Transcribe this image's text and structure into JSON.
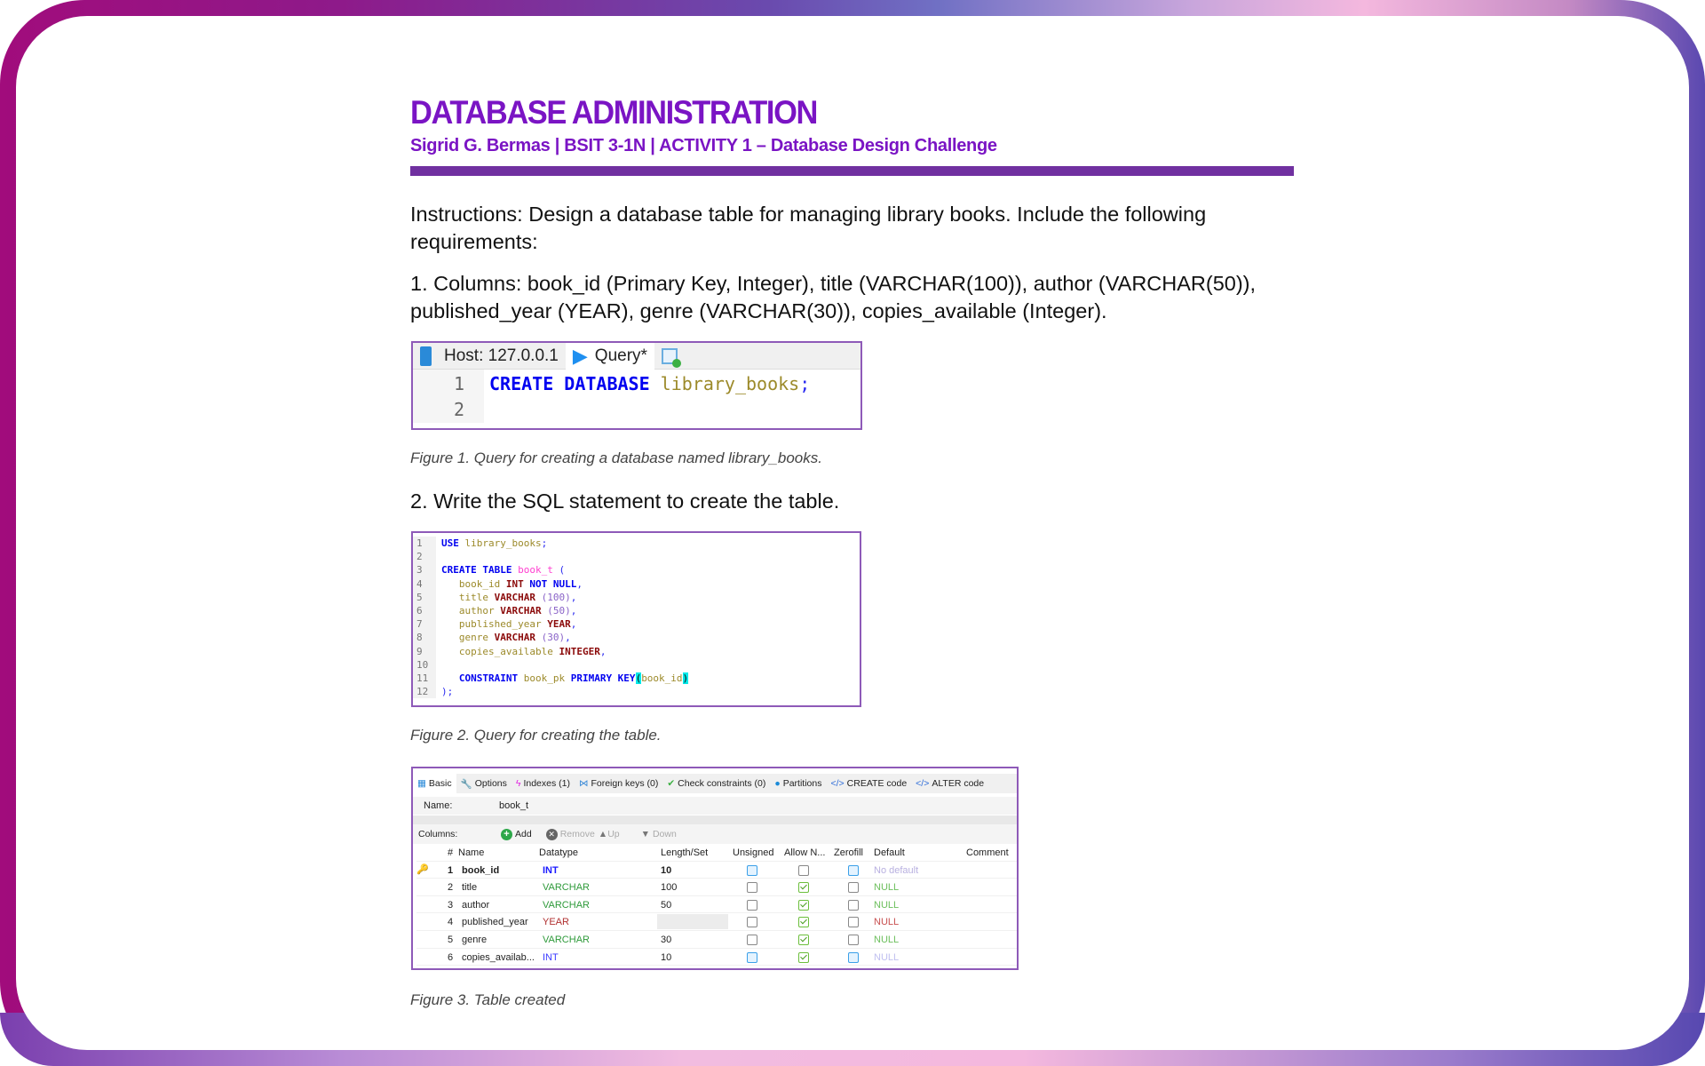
{
  "header": {
    "title": "DATABASE ADMINISTRATION",
    "subtitle": "Sigrid G. Bermas | BSIT 3-1N | ACTIVITY 1 – Database Design Challenge",
    "accent": "#7a14c4",
    "rule_color": "#7030a0"
  },
  "instructions": {
    "line1": "Instructions: Design a database table for managing library books. Include the following",
    "line2": "requirements:"
  },
  "item1": {
    "line1": "1. Columns: book_id (Primary Key, Integer), title (VARCHAR(100)), author (VARCHAR(50)),",
    "line2": "published_year (YEAR), genre (VARCHAR(30)), copies_available (Integer)."
  },
  "figure1": {
    "tabs": [
      {
        "label": "Host: 127.0.0.1",
        "icon": "server-icon"
      },
      {
        "label": "Query*",
        "icon": "play-icon"
      },
      {
        "label": "",
        "icon": "new-query-icon"
      }
    ],
    "line_numbers": [
      "1",
      "2"
    ],
    "code": [
      [
        [
          "CREATE DATABASE ",
          "kw"
        ],
        [
          "library_books",
          "id"
        ],
        [
          ";",
          "pu"
        ]
      ],
      []
    ],
    "caption": "Figure 1. Query for creating a database named library_books."
  },
  "item2": "2. Write the SQL statement to create the table.",
  "figure2": {
    "line_numbers": [
      "1",
      "2",
      "3",
      "4",
      "5",
      "6",
      "7",
      "8",
      "9",
      "10",
      "11",
      "12"
    ],
    "code": [
      [
        [
          "USE ",
          "kw"
        ],
        [
          "library_books",
          "id"
        ],
        [
          ";",
          "pu"
        ]
      ],
      [],
      [
        [
          "CREATE TABLE ",
          "kw"
        ],
        [
          "book_t",
          "tb"
        ],
        [
          " (",
          "pu"
        ]
      ],
      [
        [
          "   book_id ",
          "id"
        ],
        [
          "INT ",
          "ty"
        ],
        [
          "NOT NULL",
          "kw"
        ],
        [
          ",",
          "pu"
        ]
      ],
      [
        [
          "   title ",
          "id"
        ],
        [
          "VARCHAR ",
          "ty"
        ],
        [
          "(",
          "nu"
        ],
        [
          "100",
          "nu"
        ],
        [
          ")",
          "nu"
        ],
        [
          ",",
          "pu"
        ]
      ],
      [
        [
          "   author ",
          "id"
        ],
        [
          "VARCHAR ",
          "ty"
        ],
        [
          "(50)",
          "nu"
        ],
        [
          ",",
          "pu"
        ]
      ],
      [
        [
          "   published_year ",
          "id"
        ],
        [
          "YEAR",
          "ty"
        ],
        [
          ",",
          "pu"
        ]
      ],
      [
        [
          "   genre ",
          "id"
        ],
        [
          "VARCHAR ",
          "ty"
        ],
        [
          "(30)",
          "nu"
        ],
        [
          ",",
          "pu"
        ]
      ],
      [
        [
          "   copies_available ",
          "id"
        ],
        [
          "INTEGER",
          "ty"
        ],
        [
          ",",
          "pu"
        ]
      ],
      [],
      [
        [
          "   CONSTRAINT ",
          "kw"
        ],
        [
          "book_pk ",
          "id"
        ],
        [
          "PRIMARY KEY",
          "kw"
        ],
        [
          "(",
          "hl"
        ],
        [
          "book_id",
          "id"
        ],
        [
          ")",
          "hl"
        ]
      ],
      [
        [
          ");",
          "pu"
        ]
      ]
    ],
    "caption": "Figure 2. Query for creating the table."
  },
  "figure3": {
    "tabs": [
      {
        "label": "Basic",
        "icon": "table-icon"
      },
      {
        "label": "Options",
        "icon": "wrench-icon"
      },
      {
        "label": "Indexes (1)",
        "icon": "lightning-icon"
      },
      {
        "label": "Foreign keys (0)",
        "icon": "foreign-key-icon"
      },
      {
        "label": "Check constraints (0)",
        "icon": "check-icon"
      },
      {
        "label": "Partitions",
        "icon": "pie-icon"
      },
      {
        "label": "CREATE code",
        "icon": "code-icon"
      },
      {
        "label": "ALTER code",
        "icon": "code-icon"
      }
    ],
    "name_label": "Name:",
    "name_value": "book_t",
    "columns_label": "Columns:",
    "buttons": {
      "add": "Add",
      "remove": "Remove",
      "up": "Up",
      "down": "Down"
    },
    "headers": [
      "#",
      "Name",
      "Datatype",
      "Length/Set",
      "Unsigned",
      "Allow N...",
      "Zerofill",
      "Default",
      "Comment"
    ],
    "rows": [
      {
        "num": "1",
        "name": "book_id",
        "type": "INT",
        "type_color": "#1a1aff",
        "length": "10",
        "unsigned": "blue",
        "allow_null": "off",
        "zerofill": "blue",
        "default": "No default",
        "default_color": "#b8b0e0",
        "primary_key": true,
        "bold": true
      },
      {
        "num": "2",
        "name": "title",
        "type": "VARCHAR",
        "type_color": "#2e9a3a",
        "length": "100",
        "unsigned": "off",
        "allow_null": "checked",
        "zerofill": "off",
        "default": "NULL",
        "default_color": "#6cbf5c"
      },
      {
        "num": "3",
        "name": "author",
        "type": "VARCHAR",
        "type_color": "#2e9a3a",
        "length": "50",
        "unsigned": "off",
        "allow_null": "checked",
        "zerofill": "off",
        "default": "NULL",
        "default_color": "#6cbf5c"
      },
      {
        "num": "4",
        "name": "published_year",
        "type": "YEAR",
        "type_color": "#b03030",
        "length": "",
        "unsigned": "off",
        "allow_null": "checked",
        "zerofill": "off",
        "default": "NULL",
        "default_color": "#c85050"
      },
      {
        "num": "5",
        "name": "genre",
        "type": "VARCHAR",
        "type_color": "#2e9a3a",
        "length": "30",
        "unsigned": "off",
        "allow_null": "checked",
        "zerofill": "off",
        "default": "NULL",
        "default_color": "#6cbf5c"
      },
      {
        "num": "6",
        "name": "copies_availab...",
        "type": "INT",
        "type_color": "#3a3aff",
        "length": "10",
        "unsigned": "blue",
        "allow_null": "checked",
        "zerofill": "blue",
        "default": "NULL",
        "default_color": "#c0c0f0"
      }
    ],
    "caption": "Figure 3. Table created"
  }
}
